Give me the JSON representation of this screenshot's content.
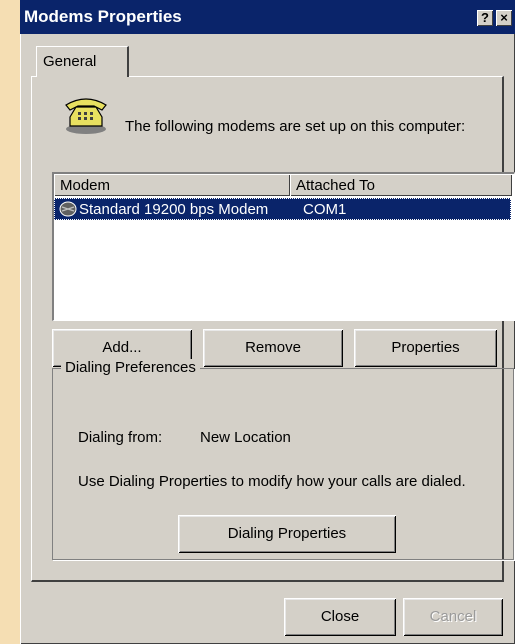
{
  "window": {
    "title": "Modems Properties",
    "help_button": "?",
    "close_button": "×"
  },
  "tabs": [
    {
      "label": "General"
    }
  ],
  "intro_text": "The following modems are set up on this computer:",
  "modem_list": {
    "columns": [
      "Modem",
      "Attached To"
    ],
    "rows": [
      {
        "modem": "Standard 19200 bps Modem",
        "attached_to": "COM1",
        "selected": true
      }
    ]
  },
  "buttons": {
    "add": "Add...",
    "remove": "Remove",
    "properties": "Properties"
  },
  "dialing_preferences": {
    "group_label": "Dialing Preferences",
    "dialing_from_label": "Dialing from:",
    "dialing_from_value": "New Location",
    "description": "Use Dialing Properties to modify how your calls are dialed.",
    "button": "Dialing Properties"
  },
  "footer": {
    "close": "Close",
    "cancel": "Cancel"
  },
  "colors": {
    "titlebar": "#0a246a",
    "selection": "#0a246a",
    "face": "#d4d0c8",
    "desktop": "#f5deb3"
  }
}
